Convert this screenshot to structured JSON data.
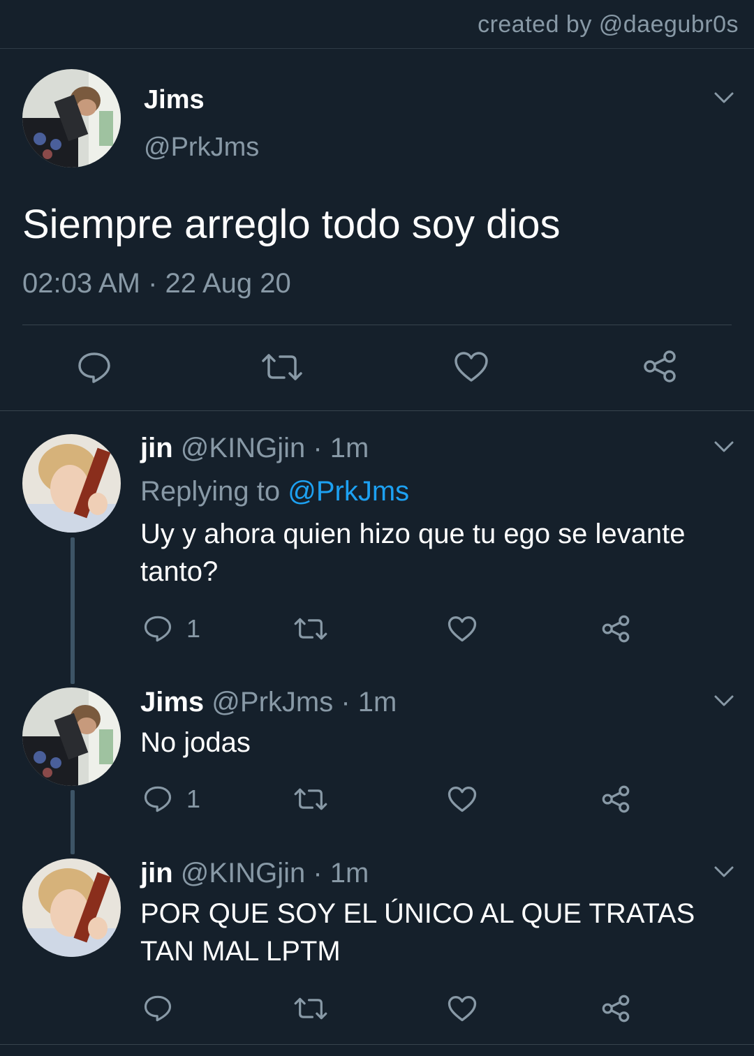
{
  "credit": "created by @daegubr0s",
  "main_tweet": {
    "name": "Jims",
    "handle": "@PrkJms",
    "text": "Siempre arreglo todo soy dios",
    "timestamp": "02:03 AM · 22 Aug 20",
    "actions": [
      "reply-icon",
      "retweet-icon",
      "like-icon",
      "share-icon"
    ]
  },
  "replies": [
    {
      "name": "jin",
      "handle": "@KINGjin",
      "time": "· 1m",
      "replying_label": "Replying to",
      "replying_to": "@PrkJms",
      "text": "Uy y ahora quien hizo que tu ego se levante tanto?",
      "reply_count": "1"
    },
    {
      "name": "Jims",
      "handle": "@PrkJms",
      "time": "· 1m",
      "text": "No jodas",
      "reply_count": "1"
    },
    {
      "name": "jin",
      "handle": "@KINGjin",
      "time": "· 1m",
      "text": "POR QUE SOY EL ÚNICO AL QUE TRATAS TAN MAL LPTM",
      "reply_count": ""
    }
  ],
  "colors": {
    "background": "#15202b",
    "secondary_text": "#8899a6",
    "mention": "#1da1f2",
    "divider": "#38444d"
  }
}
